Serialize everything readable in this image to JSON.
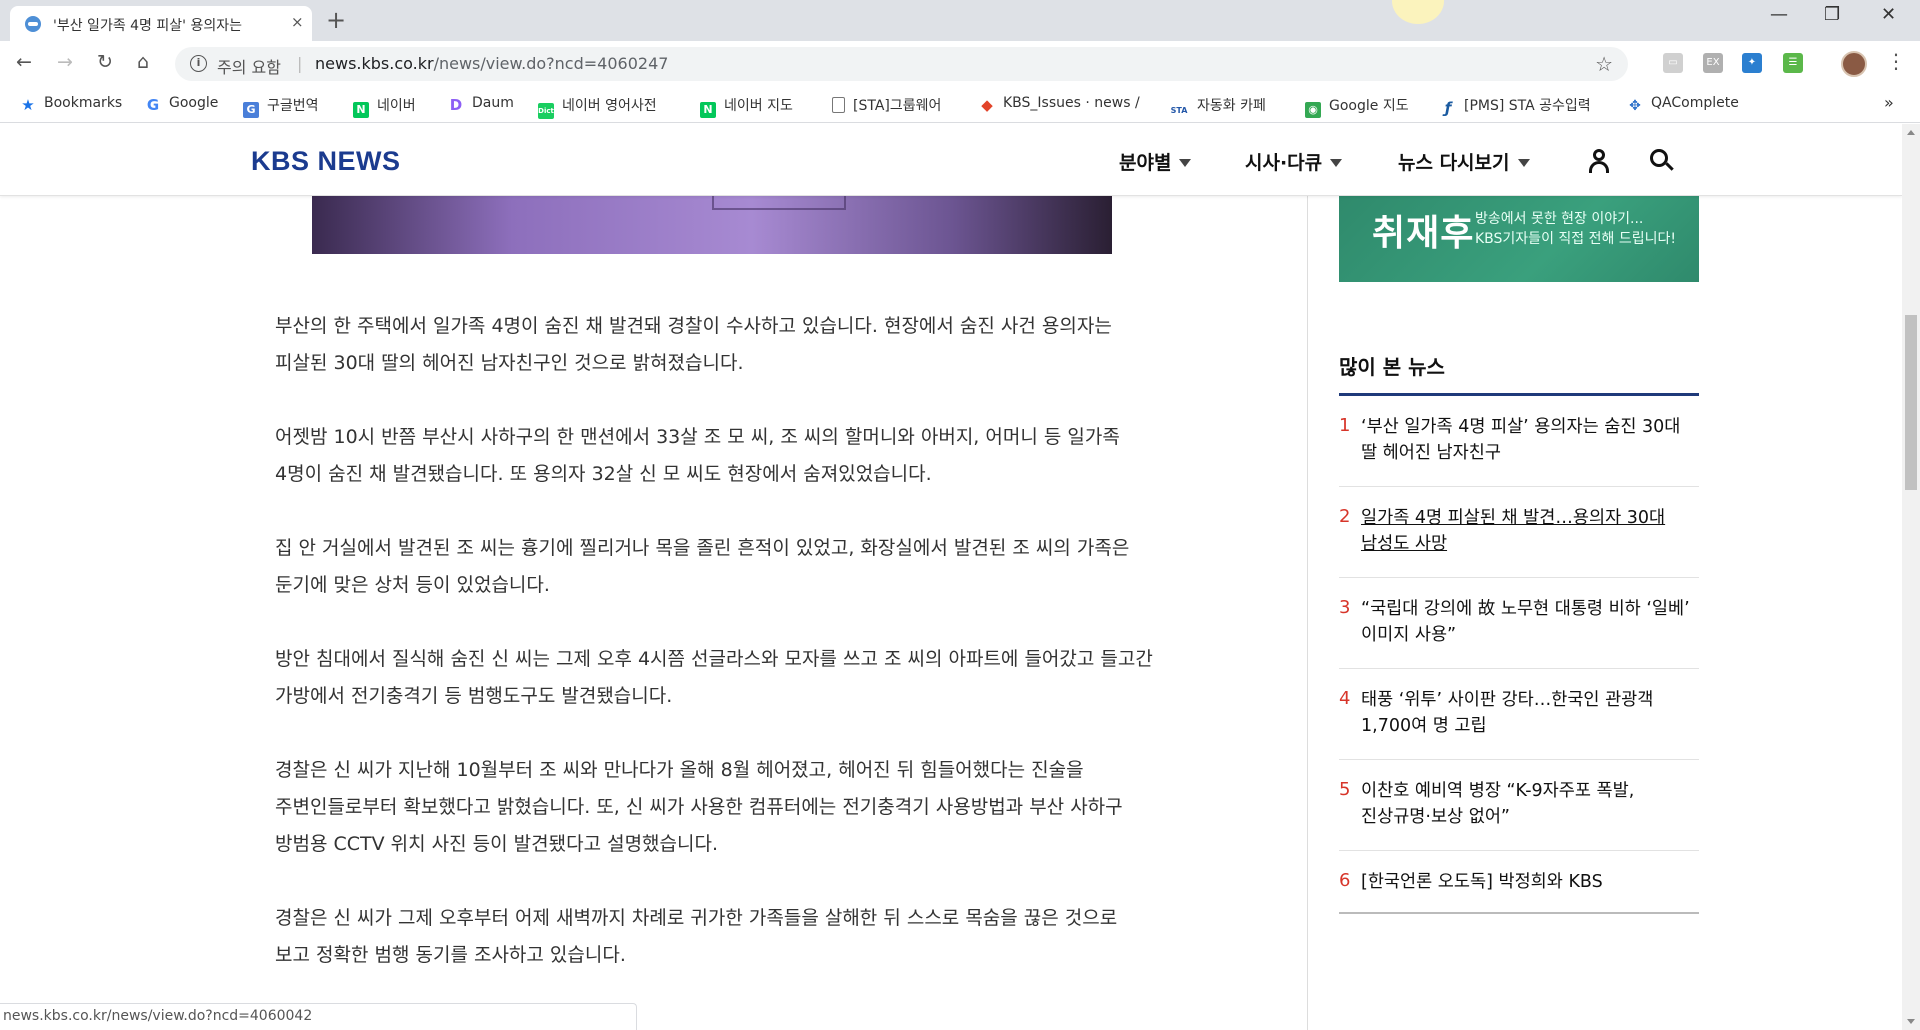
{
  "browser": {
    "tab_title": "'부산 일가족 4명 피살' 용의자는",
    "tab_close": "×",
    "new_tab": "+",
    "security_label": "주의 요함",
    "url_domain": "news.kbs.co.kr",
    "url_path": "/news/view.do?ncd=4060247",
    "window_minimize": "—",
    "window_restore": "❐",
    "window_close": "✕",
    "bookmarks": [
      {
        "label": "Bookmarks",
        "icon": "star-icon",
        "color": "#1a73e8"
      },
      {
        "label": "Google",
        "icon": "google-icon",
        "color": "#4285f4"
      },
      {
        "label": "구글번역",
        "icon": "translate-icon",
        "color": "#4a7fd9"
      },
      {
        "label": "네이버",
        "icon": "naver-icon",
        "color": "#03c75a"
      },
      {
        "label": "Daum",
        "icon": "daum-icon",
        "color": "#8d5ff5"
      },
      {
        "label": "네이버 영어사전",
        "icon": "dict-icon",
        "color": "#19ce60"
      },
      {
        "label": "네이버 지도",
        "icon": "naver-icon",
        "color": "#03c75a"
      },
      {
        "label": "[STA]그룹웨어",
        "icon": "page-icon",
        "color": "#888888"
      },
      {
        "label": "KBS_Issues · news /",
        "icon": "gitlab-icon",
        "color": "#e24329"
      },
      {
        "label": "자동화 카페",
        "icon": "sta-icon",
        "color": "#2357a8"
      },
      {
        "label": "Google 지도",
        "icon": "maps-icon",
        "color": "#34a853"
      },
      {
        "label": "[PMS] STA 공수입력",
        "icon": "pms-icon",
        "color": "#1a5aa0"
      },
      {
        "label": "QAComplete",
        "icon": "qa-icon",
        "color": "#2a6fc9"
      }
    ],
    "bookmarks_more": "»",
    "status_url": "news.kbs.co.kr/news/view.do?ncd=4060042"
  },
  "site": {
    "logo": "KBS NEWS",
    "nav": [
      "분야별",
      "시사·다큐",
      "뉴스 다시보기"
    ]
  },
  "article": {
    "paragraphs": [
      "부산의 한 주택에서 일가족 4명이 숨진 채 발견돼 경찰이 수사하고 있습니다. 현장에서 숨진 사건 용의자는 피살된 30대 딸의 헤어진 남자친구인 것으로 밝혀졌습니다.",
      "어젯밤 10시 반쯤 부산시 사하구의 한 맨션에서 33살 조 모 씨, 조 씨의 할머니와 아버지, 어머니 등 일가족 4명이 숨진 채 발견됐습니다. 또 용의자 32살 신 모 씨도 현장에서 숨져있었습니다.",
      "집 안 거실에서 발견된 조 씨는 흉기에 찔리거나 목을 졸린 흔적이 있었고, 화장실에서 발견된 조 씨의 가족은 둔기에 맞은 상처 등이 있었습니다.",
      "방안 침대에서 질식해 숨진 신 씨는 그제 오후 4시쯤 선글라스와 모자를 쓰고 조 씨의 아파트에 들어갔고 들고간 가방에서 전기충격기 등 범행도구도 발견됐습니다.",
      "경찰은 신 씨가 지난해 10월부터 조 씨와 만나다가 올해 8월 헤어졌고, 헤어진 뒤 힘들어했다는 진술을 주변인들로부터 확보했다고 밝혔습니다. 또, 신 씨가 사용한 컴퓨터에는 전기충격기 사용방법과 부산 사하구 방범용 CCTV 위치 사진 등이 발견됐다고 설명했습니다.",
      "경찰은 신 씨가 그제 오후부터 어제 새벽까지 차례로 귀가한 가족들을 살해한 뒤 스스로 목숨을 끊은 것으로 보고 정확한 범행 동기를 조사하고 있습니다."
    ]
  },
  "sidebar": {
    "banner_title": "취재후",
    "banner_sub1": "방송에서 못한 현장 이야기...",
    "banner_sub2": "KBS기자들이 직접 전해 드립니다!",
    "popular_title": "많이 본 뉴스",
    "popular": [
      {
        "num": "1",
        "text": "‘부산 일가족 4명 피살’ 용의자는 숨진 30대 딸 헤어진 남자친구"
      },
      {
        "num": "2",
        "text": "일가족 4명 피살된 채 발견…용의자 30대 남성도 사망"
      },
      {
        "num": "3",
        "text": "“국립대 강의에 故 노무현 대통령 비하 ‘일베’ 이미지 사용”"
      },
      {
        "num": "4",
        "text": "태풍 ‘위투’ 사이판 강타…한국인 관광객 1,700여 명 고립"
      },
      {
        "num": "5",
        "text": "이찬호 예비역 병장 “K-9자주포 폭발, 진상규명·보상 없어”"
      },
      {
        "num": "6",
        "text": "[한국언론 오도독] 박정희와 KBS"
      }
    ]
  },
  "colors": {
    "brand": "#1b3b8f",
    "rank_number": "#d7352a",
    "banner": "#3aa07d"
  }
}
